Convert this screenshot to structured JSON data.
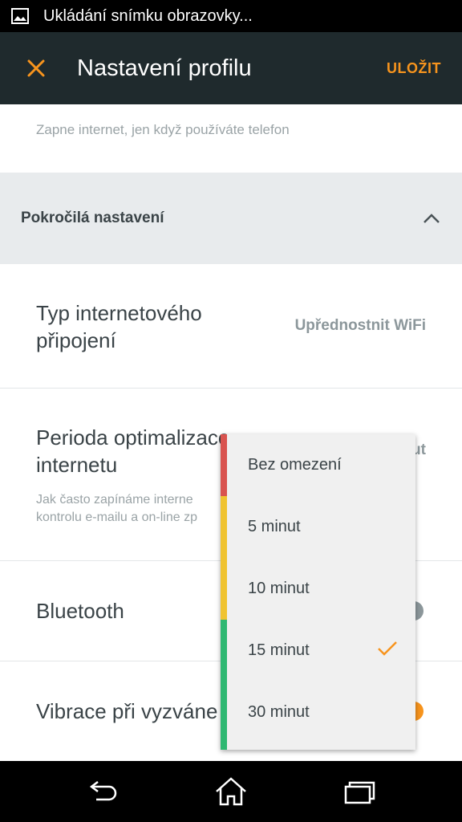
{
  "status_bar": {
    "notification_icon": "image-icon",
    "text": "Ukládání snímku obrazovky..."
  },
  "app_bar": {
    "close_icon": "close-icon",
    "title": "Nastavení profilu",
    "save_label": "ULOŽIT"
  },
  "content": {
    "top_description": "Zapne internet, jen když používáte telefon",
    "section": {
      "label": "Pokročilá nastavení",
      "icon": "chevron-up-icon"
    },
    "rows": {
      "connection": {
        "label_line1": "Typ internetového",
        "label_line2": "připojení",
        "value": "Upřednostnit WiFi"
      },
      "optimization": {
        "label_line1": "Perioda optimalizace",
        "label_line2": "internetu",
        "value_visible_fragment": "ut",
        "desc_line1": "Jak často zapínáme interne",
        "desc_line2": "kontrolu e-mailu a on-line zp"
      },
      "bluetooth": {
        "label": "Bluetooth"
      },
      "vibration": {
        "label": "Vibrace při vyzváne"
      }
    }
  },
  "dropdown": {
    "options": [
      "Bez omezení",
      "5 minut",
      "10 minut",
      "15 minut",
      "30 minut"
    ],
    "selected": "15 minut",
    "stripe_colors": [
      "#d9534f",
      "#f0c330",
      "#f0c330",
      "#2eb872",
      "#2eb872"
    ]
  },
  "colors": {
    "accent": "#f7941d",
    "app_bar": "#1f2a2d",
    "section_bg": "#e8ebed"
  },
  "nav_bar": {
    "icons": [
      "back-icon",
      "home-icon",
      "recents-icon"
    ]
  }
}
